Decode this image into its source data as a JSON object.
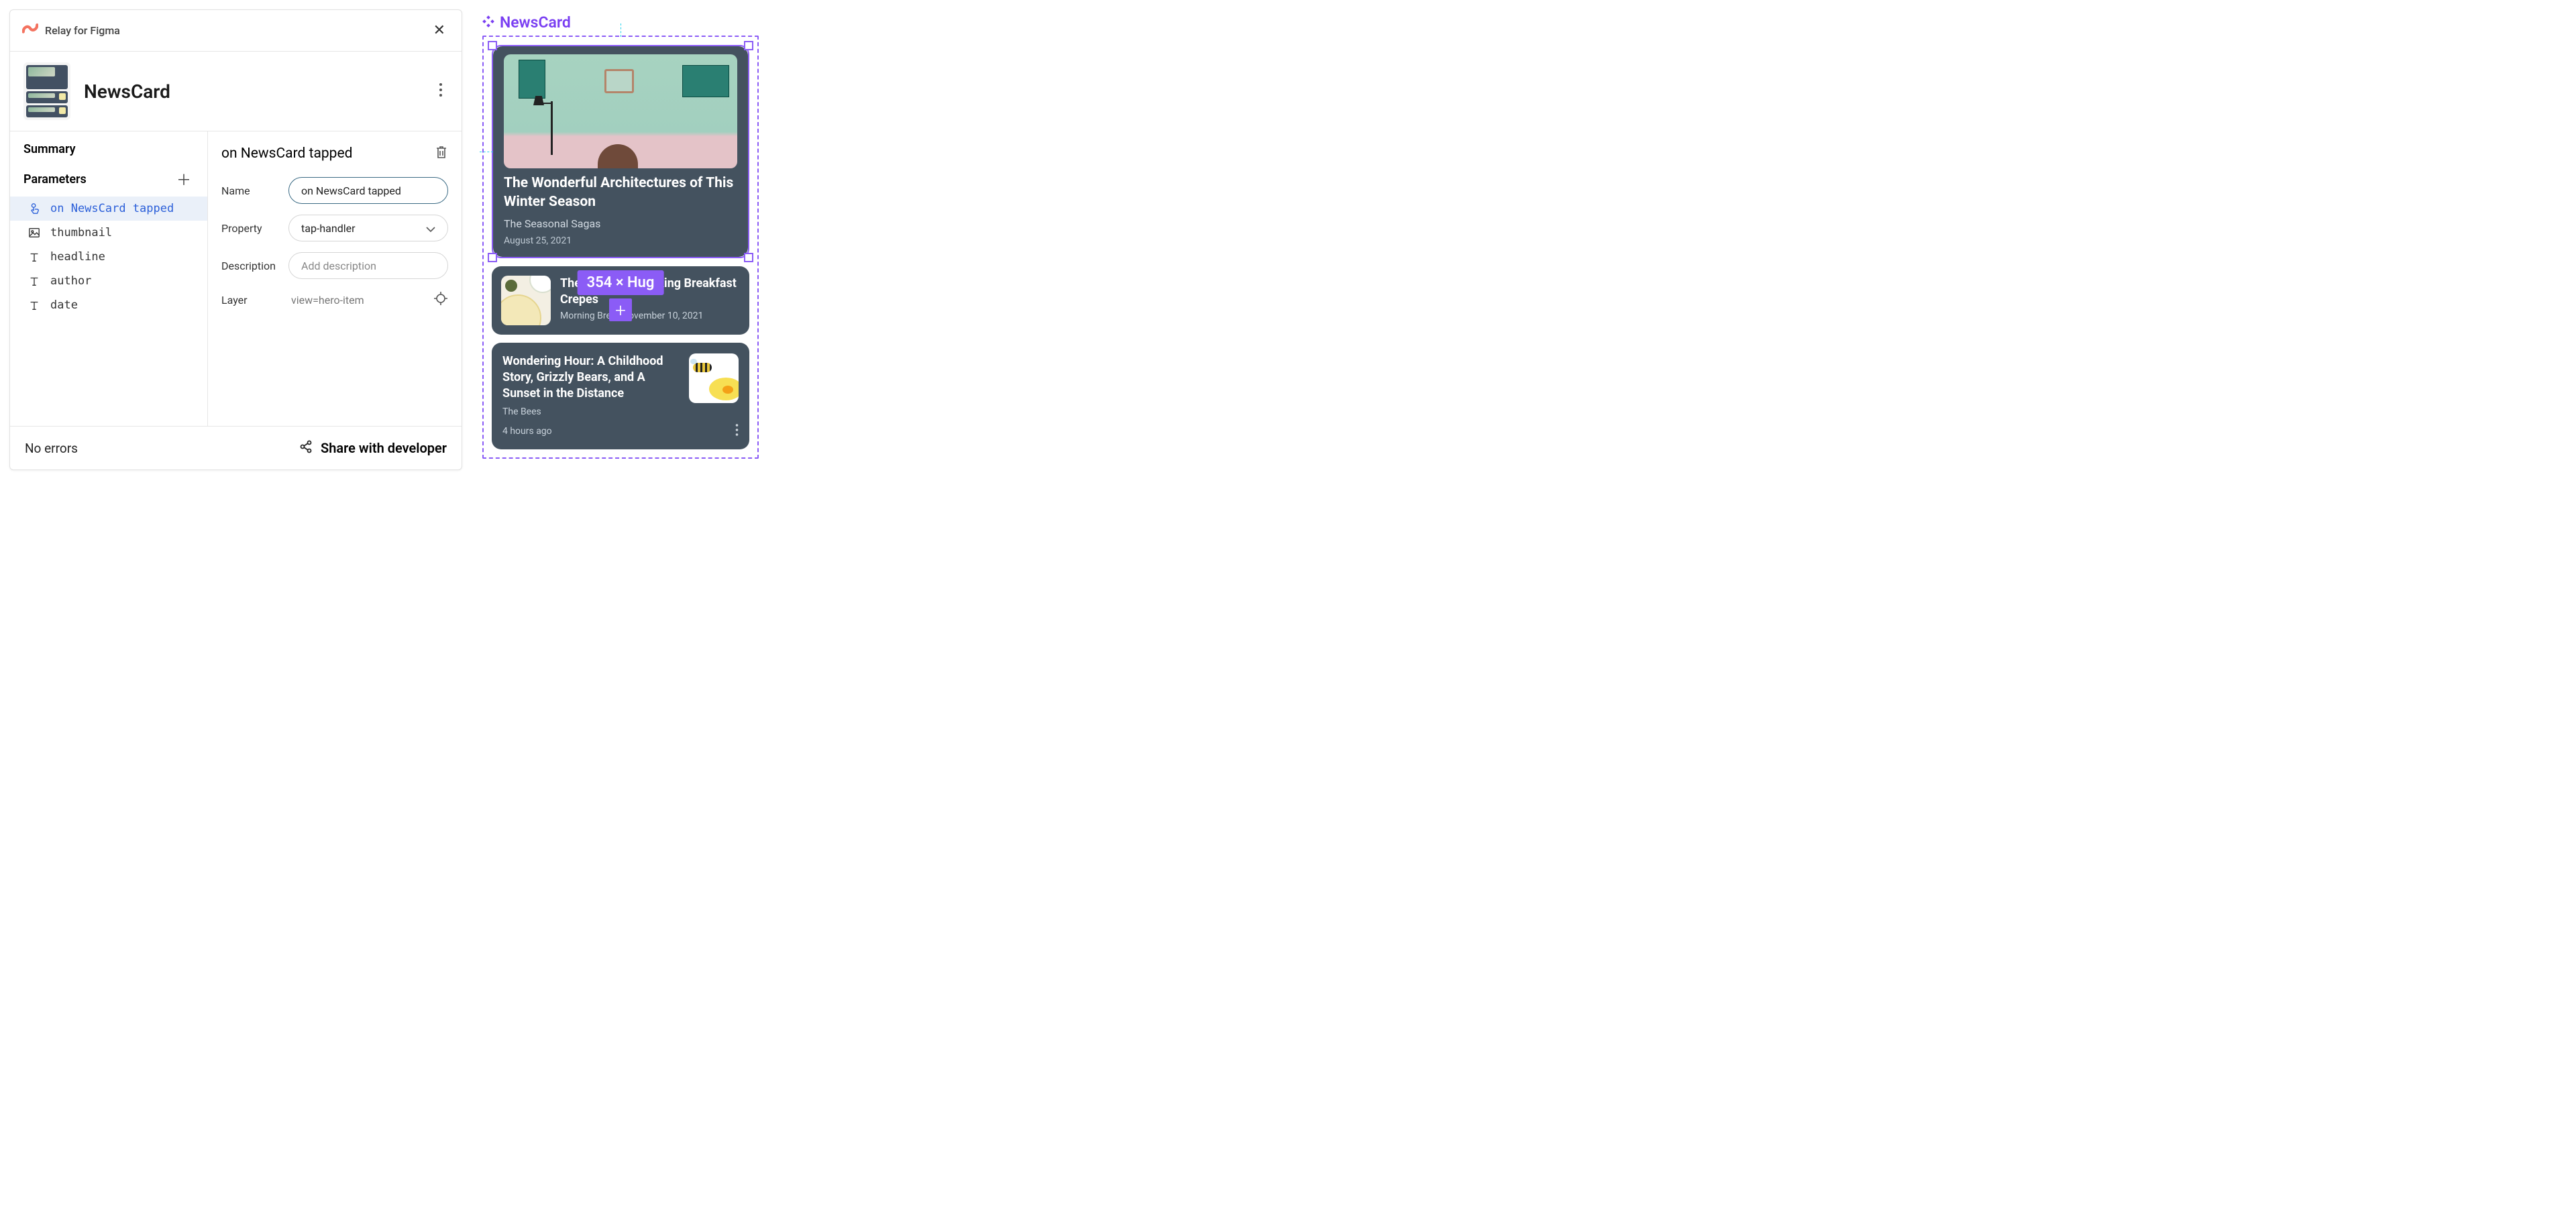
{
  "plugin": {
    "name": "Relay for Figma"
  },
  "header": {
    "component_name": "NewsCard"
  },
  "sidebar": {
    "summary_label": "Summary",
    "parameters_label": "Parameters",
    "params": [
      {
        "id": "on-tap",
        "label": "on NewsCard tapped",
        "icon": "tap",
        "selected": true
      },
      {
        "id": "thumb",
        "label": "thumbnail",
        "icon": "image",
        "selected": false
      },
      {
        "id": "headline",
        "label": "headline",
        "icon": "text",
        "selected": false
      },
      {
        "id": "author",
        "label": "author",
        "icon": "text",
        "selected": false
      },
      {
        "id": "date",
        "label": "date",
        "icon": "text",
        "selected": false
      }
    ]
  },
  "detail": {
    "title": "on NewsCard tapped",
    "labels": {
      "name": "Name",
      "property": "Property",
      "description": "Description",
      "layer": "Layer"
    },
    "name_value": "on NewsCard tapped",
    "property_value": "tap-handler",
    "description_placeholder": "Add description",
    "layer_value": "view=hero-item"
  },
  "footer": {
    "errors": "No errors",
    "share": "Share with developer"
  },
  "canvas": {
    "component_label": "NewsCard",
    "dimension_badge": "354 × Hug",
    "cards": {
      "hero": {
        "title": "The Wonderful Architectures of This Winter Season",
        "author": "The Seasonal Sagas",
        "date": "August 25, 2021"
      },
      "row1": {
        "title_prefix": "The",
        "title_suffix": "Making Breakfast Crepes",
        "meta_prefix": "Morning Bre",
        "meta_suffix": "ovember 10, 2021"
      },
      "row2": {
        "title": "Wondering Hour: A Childhood Story, Grizzly Bears, and A Sunset in the Distance",
        "author": "The Bees",
        "time": "4 hours ago"
      }
    }
  }
}
